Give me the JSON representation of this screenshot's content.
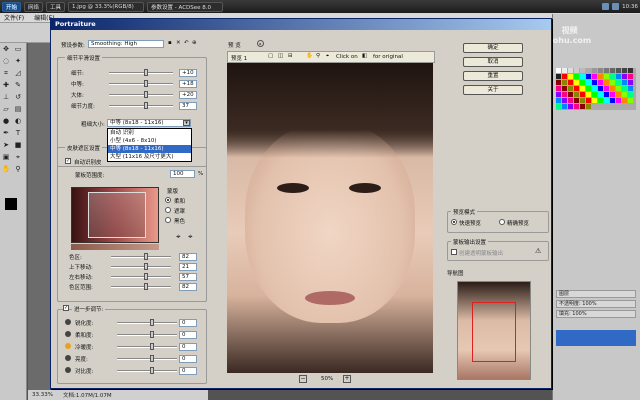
{
  "taskbar": {
    "logo": "开始",
    "items": [
      "网络",
      "工具",
      "1.jpg @ 33.3%(RGB/8)",
      "参数设置 - ACDSee 8.0"
    ],
    "clock": "10:36"
  },
  "ps_menu": [
    "文件(F)",
    "编辑(E)"
  ],
  "ps_status": {
    "zoom": "33.33%",
    "doc": "文档:1.07M/1.07M"
  },
  "watermark": {
    "line1": "视频",
    "line2": "sohu.com"
  },
  "right_panel": {
    "rows": [
      "图层",
      "不透明度: 100%",
      "填充: 100%"
    ]
  },
  "dialog": {
    "title": "Portraiture",
    "preset_label": "预设参数:",
    "preset_value": "Smoothing: High",
    "detail_group": "细节平滑设置",
    "detail_sliders": [
      {
        "label": "细节:",
        "value": "+10"
      },
      {
        "label": "中等:",
        "value": "+18"
      },
      {
        "label": "大体:",
        "value": "+20"
      },
      {
        "label": "细节力度:",
        "value": "37"
      }
    ],
    "size_label": "粗细大小:",
    "size_value": "中等 (8x18 - 11x16)",
    "dropdown_options": [
      "自动 识别",
      "小型 (4x6 - 8x10)",
      "中等 (8x18 - 11x16)",
      "大型 (11x16 及尺寸更大)"
    ],
    "dropdown_selected_index": 2,
    "skin_group": "皮肤遮区设置",
    "auto_detect_label": "自动识别皮",
    "mask_label": "蒙板范围度:",
    "mask_value": "100",
    "mask_unit": "%",
    "mask_options": [
      "柔和",
      "遮罩",
      "黑色"
    ],
    "mask_options_header": "蒙版",
    "skin_sliders": [
      {
        "label": "色区:",
        "value": "82"
      },
      {
        "label": "上下移动:",
        "value": "21"
      },
      {
        "label": "左右移动:",
        "value": "57"
      },
      {
        "label": "色区范围:",
        "value": "82"
      }
    ],
    "enhance_label": "进一步调节:",
    "enhance_sliders": [
      {
        "label": "锐化度:",
        "value": "0"
      },
      {
        "label": "柔和度:",
        "value": "0"
      },
      {
        "label": "冷暖度:",
        "value": "0"
      },
      {
        "label": "亮度:",
        "value": "0"
      },
      {
        "label": "对比度:",
        "value": "0"
      }
    ],
    "preview_label": "预 览",
    "preview_tab": "预览 1",
    "click_hint": "Click on",
    "for_original": "for original",
    "zoom_value": "50%",
    "buttons": [
      "确定",
      "取消",
      "重置",
      "关于"
    ],
    "preview_mode_group": "预览模式",
    "preview_modes": [
      "快速预览",
      "精确预览"
    ],
    "preview_mode_selected": 0,
    "mask_output_group": "蒙板输出设置",
    "mask_output_label": "创建透明蒙板输出",
    "navigator_label": "导航图"
  }
}
